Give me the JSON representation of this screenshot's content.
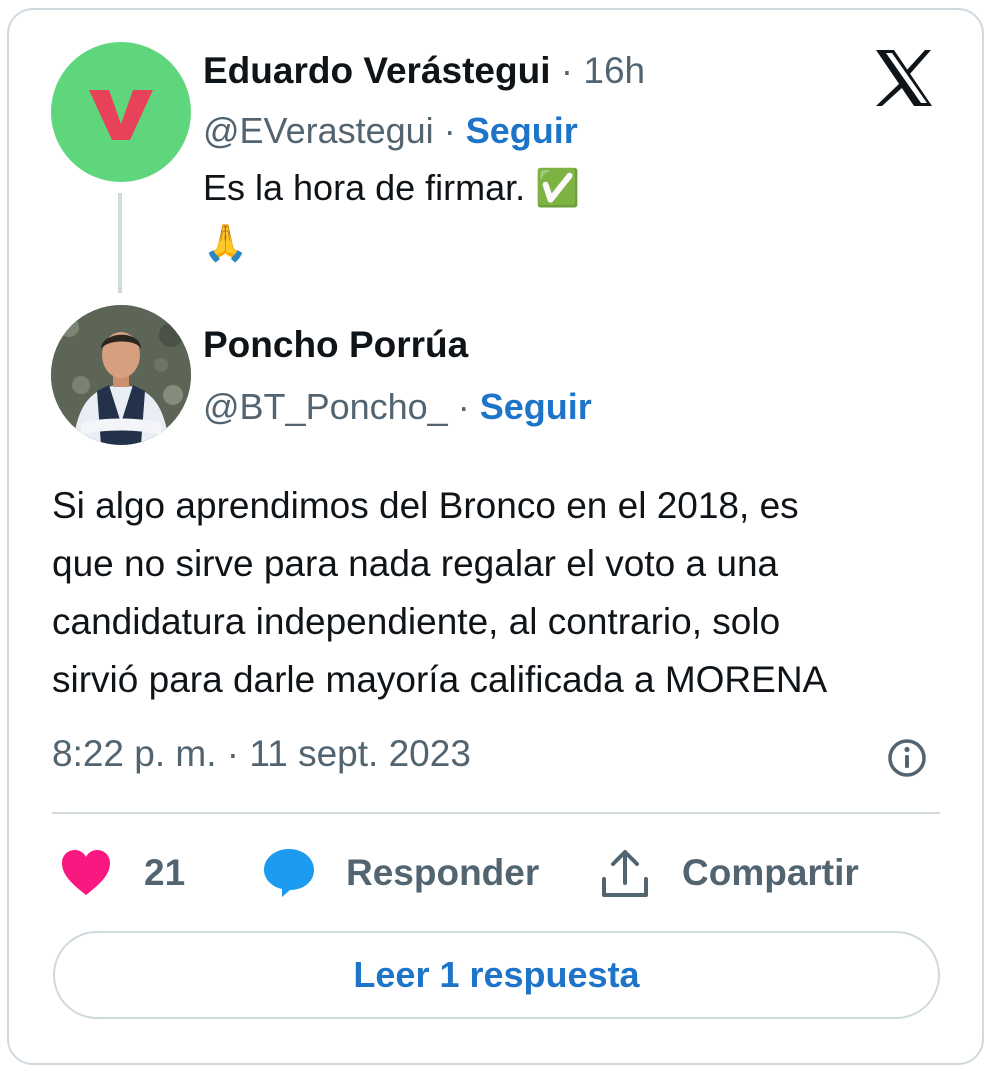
{
  "parent_tweet": {
    "author_name": "Eduardo Verástegui",
    "separator": "·",
    "time_ago": "16h",
    "handle": "@EVerastegui",
    "follow_label": "Seguir",
    "text": "Es la hora de firmar.",
    "emoji_check": "✅",
    "emoji_pray": "🙏",
    "avatar_letter": "V"
  },
  "tweet": {
    "author_name": "Poncho Porrúa",
    "handle": "@BT_Poncho_",
    "follow_label": "Seguir",
    "body_lines": [
      "Si algo aprendimos del Bronco en el 2018, es",
      "que no sirve para nada regalar el voto a una",
      "candidatura independiente, al contrario, solo",
      "sirvió para darle mayoría calificada a MORENA"
    ],
    "timestamp": "8:22 p. m. · 11 sept. 2023"
  },
  "actions": {
    "like_count": "21",
    "reply_label": "Responder",
    "share_label": "Compartir"
  },
  "read_replies_label": "Leer 1 respuesta",
  "colors": {
    "accent": "#1d74c8",
    "like": "#f91880",
    "reply_bubble": "#1d9bf0",
    "avatar_green": "#5fd67b",
    "avatar_v": "#e8425b",
    "muted": "#536471",
    "border": "#cfd9de"
  },
  "icons": [
    "x-logo-icon",
    "verified-check-emoji",
    "pray-emoji",
    "heart-icon",
    "speech-bubble-icon",
    "share-icon",
    "info-icon"
  ]
}
